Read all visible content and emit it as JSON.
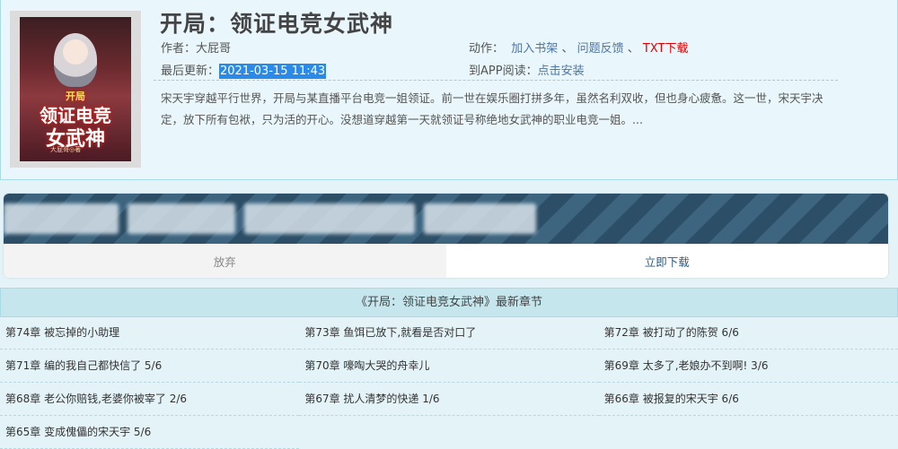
{
  "book": {
    "title": "开局：领证电竞女武神",
    "author_label": "作者：",
    "author": "大屁哥",
    "update_label": "最后更新：",
    "update_time": "2021-03-15 11:43",
    "action_label": "动作：",
    "actions": {
      "add_shelf": "加入书架",
      "sep1": "、",
      "feedback": "问题反馈",
      "sep2": "、",
      "txt_download": "TXT下载"
    },
    "app_label": "到APP阅读：",
    "app_install": "点击安装",
    "intro": "宋天宇穿越平行世界，开局与某直播平台电竞一姐领证。前一世在娱乐圈打拼多年，虽然名利双收，但也身心疲惫。这一世，宋天宇决定，放下所有包袱，只为活的开心。没想道穿越第一天就领证号称绝地女武神的职业电竞一姐。..."
  },
  "cover": {
    "line1": "开局",
    "line2": "领证电竞",
    "line3": "女武神",
    "author": "大屁哥◎著"
  },
  "banner": {
    "abandon": "放弃",
    "download": "立即下载"
  },
  "chapters": {
    "header": "《开局：领证电竞女武神》最新章节",
    "items": [
      "第74章 被忘掉的小助理",
      "第73章 鱼饵已放下,就看是否对口了",
      "第72章 被打动了的陈贺 6/6",
      "第71章 编的我自己都快信了 5/6",
      "第70章 嚎啕大哭的舟幸儿",
      "第69章 太多了,老娘办不到啊! 3/6",
      "第68章 老公你赔钱,老婆你被宰了 2/6",
      "第67章 扰人清梦的快递 1/6",
      "第66章 被报复的宋天宇 6/6",
      "第65章 变成傀儡的宋天宇 5/6"
    ]
  }
}
